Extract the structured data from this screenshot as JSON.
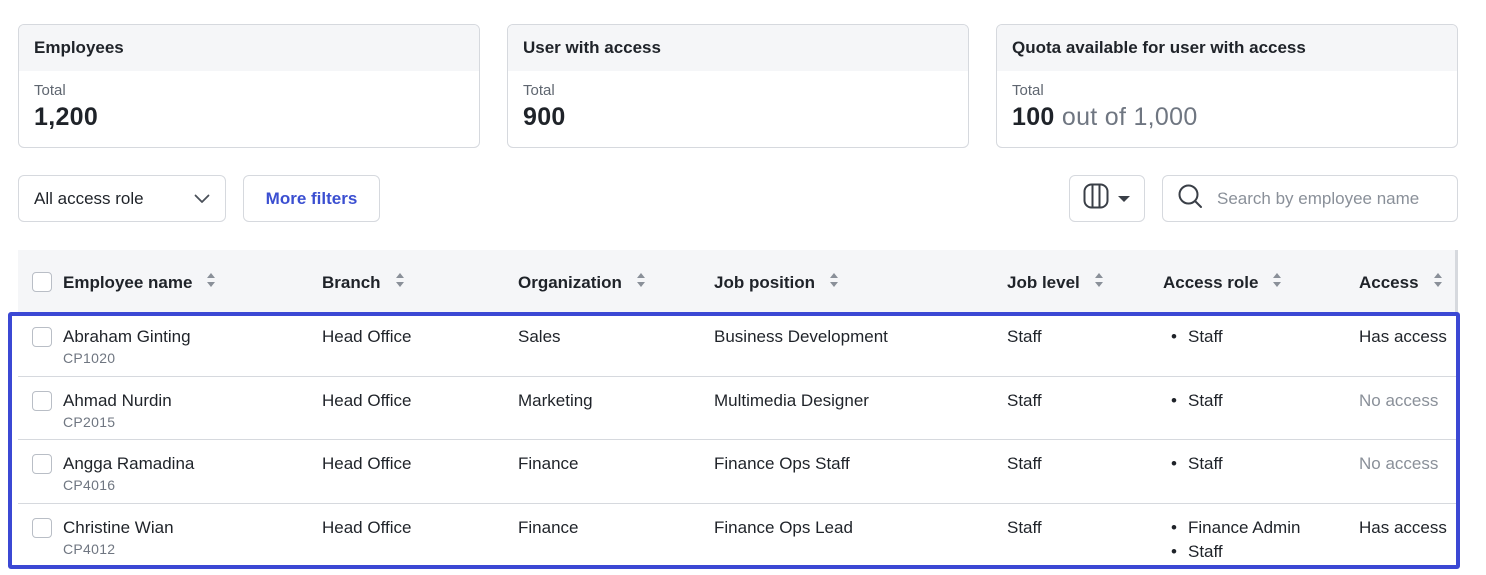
{
  "cards": [
    {
      "title": "Employees",
      "sub": "Total",
      "value": "1,200",
      "value_suffix": ""
    },
    {
      "title": "User with access",
      "sub": "Total",
      "value": "900",
      "value_suffix": ""
    },
    {
      "title": "Quota available for user with access",
      "sub": "Total",
      "value": "100",
      "value_suffix": "out of 1,000"
    }
  ],
  "toolbar": {
    "role_filter": "All access role",
    "more_filters": "More filters",
    "search_placeholder": "Search by employee name"
  },
  "table": {
    "headers": {
      "name": "Employee name",
      "branch": "Branch",
      "organization": "Organization",
      "job_position": "Job position",
      "job_level": "Job level",
      "access_role": "Access role",
      "access": "Access"
    },
    "rows": [
      {
        "name": "Abraham Ginting",
        "id": "CP1020",
        "branch": "Head Office",
        "organization": "Sales",
        "job_position": "Business Development",
        "job_level": "Staff",
        "roles": [
          "Staff"
        ],
        "access": "Has access"
      },
      {
        "name": "Ahmad Nurdin",
        "id": "CP2015",
        "branch": "Head Office",
        "organization": "Marketing",
        "job_position": "Multimedia Designer",
        "job_level": "Staff",
        "roles": [
          "Staff"
        ],
        "access": "No access"
      },
      {
        "name": "Angga Ramadina",
        "id": "CP4016",
        "branch": "Head Office",
        "organization": "Finance",
        "job_position": "Finance Ops Staff",
        "job_level": "Staff",
        "roles": [
          "Staff"
        ],
        "access": "No access"
      },
      {
        "name": "Christine Wian",
        "id": "CP4012",
        "branch": "Head Office",
        "organization": "Finance",
        "job_position": "Finance Ops Lead",
        "job_level": "Staff",
        "roles": [
          "Finance Admin",
          "Staff"
        ],
        "access": "Has access"
      }
    ]
  },
  "colors": {
    "accent": "#3b4fd1",
    "highlight_border": "#3b48d4",
    "header_bg": "#f5f6f8",
    "muted_text": "#8a9099"
  },
  "icons": {
    "role_filter": "chevron-down-icon",
    "column_toggle": "columns-icon",
    "column_toggle_caret": "caret-down-icon",
    "search": "search-icon",
    "sort": "sort-icon"
  }
}
